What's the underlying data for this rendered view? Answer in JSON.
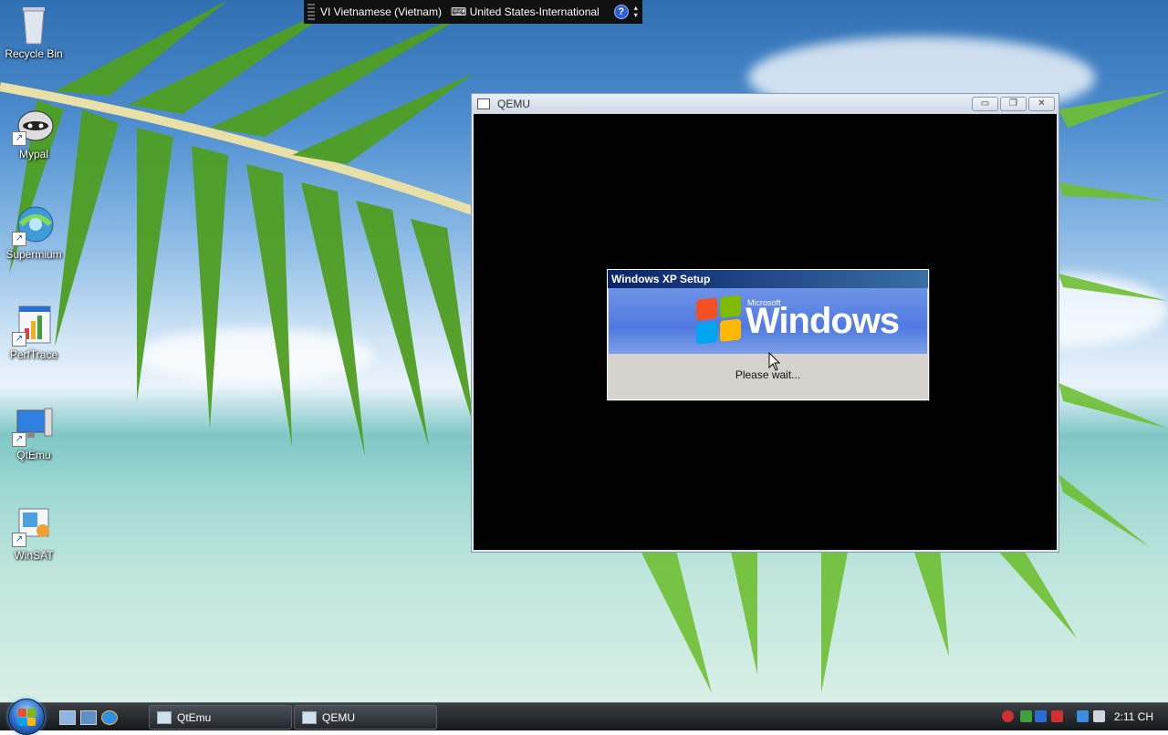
{
  "language_bar": {
    "language": "VI Vietnamese (Vietnam)",
    "keyboard": "United States-International",
    "help_icon": "help-icon"
  },
  "desktop_icons": [
    {
      "label": "Recycle Bin",
      "icon": "recycle-bin-icon"
    },
    {
      "label": "Mypal",
      "icon": "raccoon-icon"
    },
    {
      "label": "Supermium",
      "icon": "globe-icon"
    },
    {
      "label": "PerfTrace",
      "icon": "chart-icon"
    },
    {
      "label": "QtEmu",
      "icon": "monitor-icon"
    },
    {
      "label": "WinSAT",
      "icon": "monitor-icon"
    }
  ],
  "qemu_window": {
    "title": "QEMU",
    "buttons": {
      "minimize": "▭",
      "restore": "❐",
      "close": "✕"
    }
  },
  "xp_setup": {
    "title": "Windows XP Setup",
    "brand_small": "Microsoft",
    "brand": "Windows",
    "status": "Please wait..."
  },
  "taskbar": {
    "tasks": [
      {
        "label": "QtEmu"
      },
      {
        "label": "QEMU"
      }
    ],
    "clock": "2:11 CH"
  },
  "colors": {
    "taskbar": "#1e2227",
    "xp_title": "#0a246a",
    "xp_banner": "#5a82e2"
  }
}
